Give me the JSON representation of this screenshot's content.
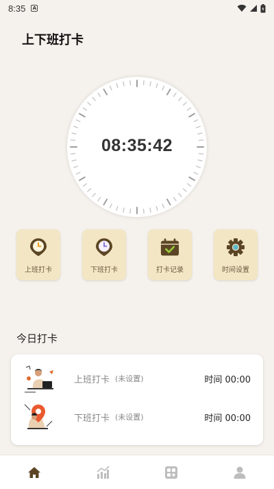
{
  "status_bar": {
    "time": "8:35",
    "notification_glyph": "A"
  },
  "header": {
    "title": "上下班打卡"
  },
  "clock": {
    "time": "08:35:42"
  },
  "actions": [
    {
      "label": "上班打卡",
      "icon": "clock-pin-icon"
    },
    {
      "label": "下班打卡",
      "icon": "clock-pin-icon"
    },
    {
      "label": "打卡记录",
      "icon": "calendar-check-icon"
    },
    {
      "label": "时间设置",
      "icon": "gear-icon"
    }
  ],
  "today": {
    "title": "今日打卡",
    "rows": [
      {
        "label": "上班打卡",
        "note": "(未设置)",
        "time": "时间 00:00"
      },
      {
        "label": "下班打卡",
        "note": "(未设置)",
        "time": "时间 00:00"
      }
    ]
  },
  "tabbar": [
    {
      "name": "home",
      "icon": "home-icon"
    },
    {
      "name": "stats",
      "icon": "chart-icon"
    },
    {
      "name": "apps",
      "icon": "grid-icon"
    },
    {
      "name": "profile",
      "icon": "user-icon"
    }
  ],
  "colors": {
    "accent": "#5b4524",
    "card_bg": "#f3e6c4",
    "page_bg": "#f5f1ec",
    "tab_inactive": "#bdbdbd"
  }
}
